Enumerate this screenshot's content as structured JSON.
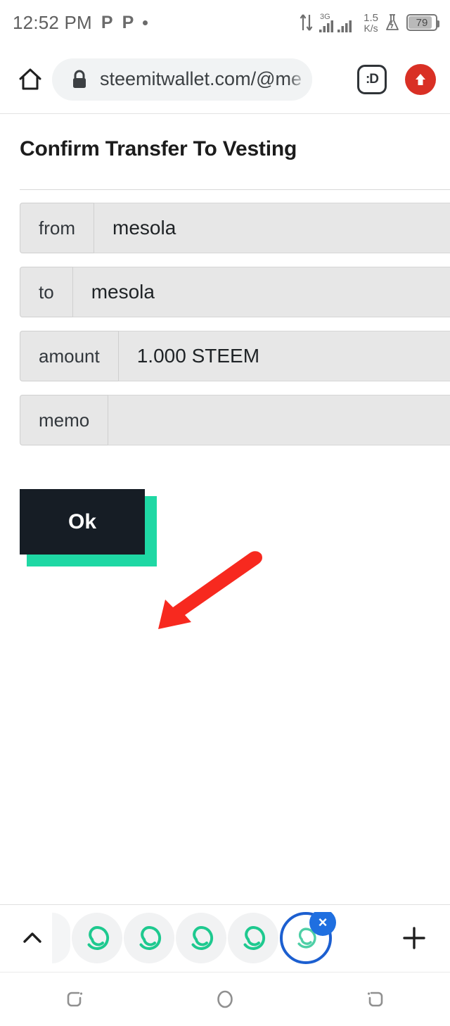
{
  "status_bar": {
    "time": "12:52 PM",
    "notif_1": "P",
    "notif_2": "P",
    "network_type": "3G",
    "speed_value": "1.5",
    "speed_unit": "K/s",
    "battery_percent": "79"
  },
  "browser": {
    "url": "steemitwallet.com/@me",
    "url_truncated": true,
    "home_label": "Home",
    "extension_label": ":D",
    "upload_label": "Upload"
  },
  "page": {
    "title": "Confirm Transfer To Vesting",
    "rows": [
      {
        "label": "from",
        "value": "mesola"
      },
      {
        "label": "to",
        "value": "mesola"
      },
      {
        "label": "amount",
        "value": "1.000 STEEM"
      },
      {
        "label": "memo",
        "value": ""
      }
    ],
    "confirm_button": "Ok"
  },
  "annotation": {
    "arrow_color": "#f7291f",
    "points_to": "Ok"
  },
  "tab_strip": {
    "tab_count": 5,
    "active_tab_index": 4,
    "close_label": "×",
    "new_tab_label": "+",
    "expand_label": "^"
  },
  "nav_bar": {
    "recents_label": "Recents",
    "home_label": "Home",
    "back_label": "Back"
  },
  "colors": {
    "accent_teal": "#1fd8a4",
    "button_dark": "#161d25",
    "arrow_red": "#f7291f",
    "tab_blue": "#1f6fe0",
    "upload_red": "#d93025",
    "field_gray": "#e7e7e7"
  }
}
